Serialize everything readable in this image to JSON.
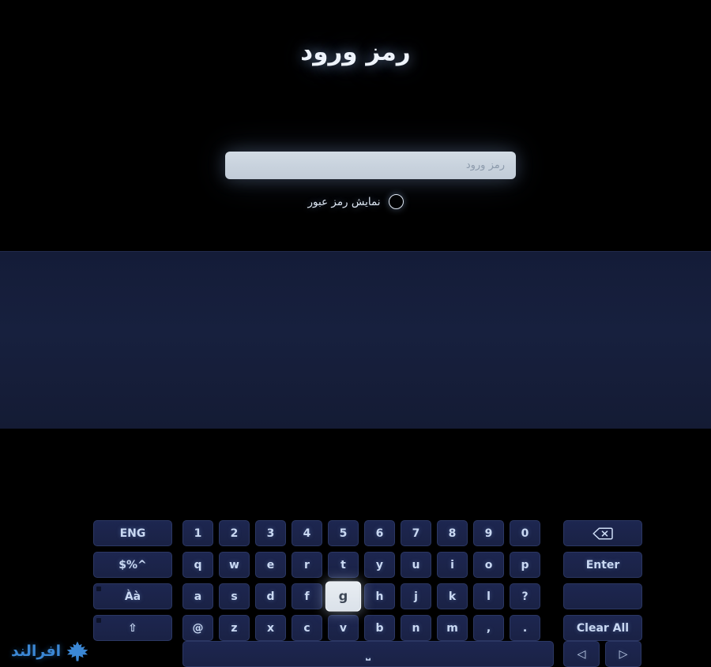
{
  "screen": {
    "title": "رمز ورود",
    "background_color": "#000000",
    "panel_color": "#17203e"
  },
  "password_form": {
    "input_value": "",
    "input_placeholder": "رمز ورود",
    "show_password_label": "نمایش رمز عبور",
    "show_password_checked": false,
    "toggle_icon": "radio-circle-icon"
  },
  "keyboard": {
    "selected_key": "g",
    "left_column": [
      {
        "label": "ENG",
        "name": "key-language",
        "corner_dot": false
      },
      {
        "label": "$%^",
        "name": "key-symbols",
        "corner_dot": false
      },
      {
        "label": "Àà",
        "name": "key-accents",
        "corner_dot": true
      },
      {
        "label": "⇧",
        "name": "key-shift",
        "corner_dot": true
      }
    ],
    "main_rows": [
      [
        "1",
        "2",
        "3",
        "4",
        "5",
        "6",
        "7",
        "8",
        "9",
        "0"
      ],
      [
        "q",
        "w",
        "e",
        "r",
        "t",
        "y",
        "u",
        "i",
        "o",
        "p"
      ],
      [
        "a",
        "s",
        "d",
        "f",
        "g",
        "h",
        "j",
        "k",
        "l",
        "?"
      ],
      [
        "@",
        "z",
        "x",
        "c",
        "v",
        "b",
        "n",
        "m",
        ",",
        "."
      ]
    ],
    "right_column": [
      {
        "label": "",
        "name": "key-backspace",
        "icon": "backspace-icon"
      },
      {
        "label": "Enter",
        "name": "key-enter",
        "icon": ""
      },
      {
        "label": "",
        "name": "key-blank",
        "icon": ""
      },
      {
        "label": "Clear All",
        "name": "key-clear-all",
        "icon": ""
      }
    ],
    "bottom_row": {
      "space_label": "⎵",
      "space_name": "key-space",
      "arrow_left": "◁",
      "arrow_right": "▷"
    }
  },
  "watermark": {
    "text": "افرالند",
    "icon": "maple-leaf-icon",
    "color": "#3f8fe0"
  }
}
